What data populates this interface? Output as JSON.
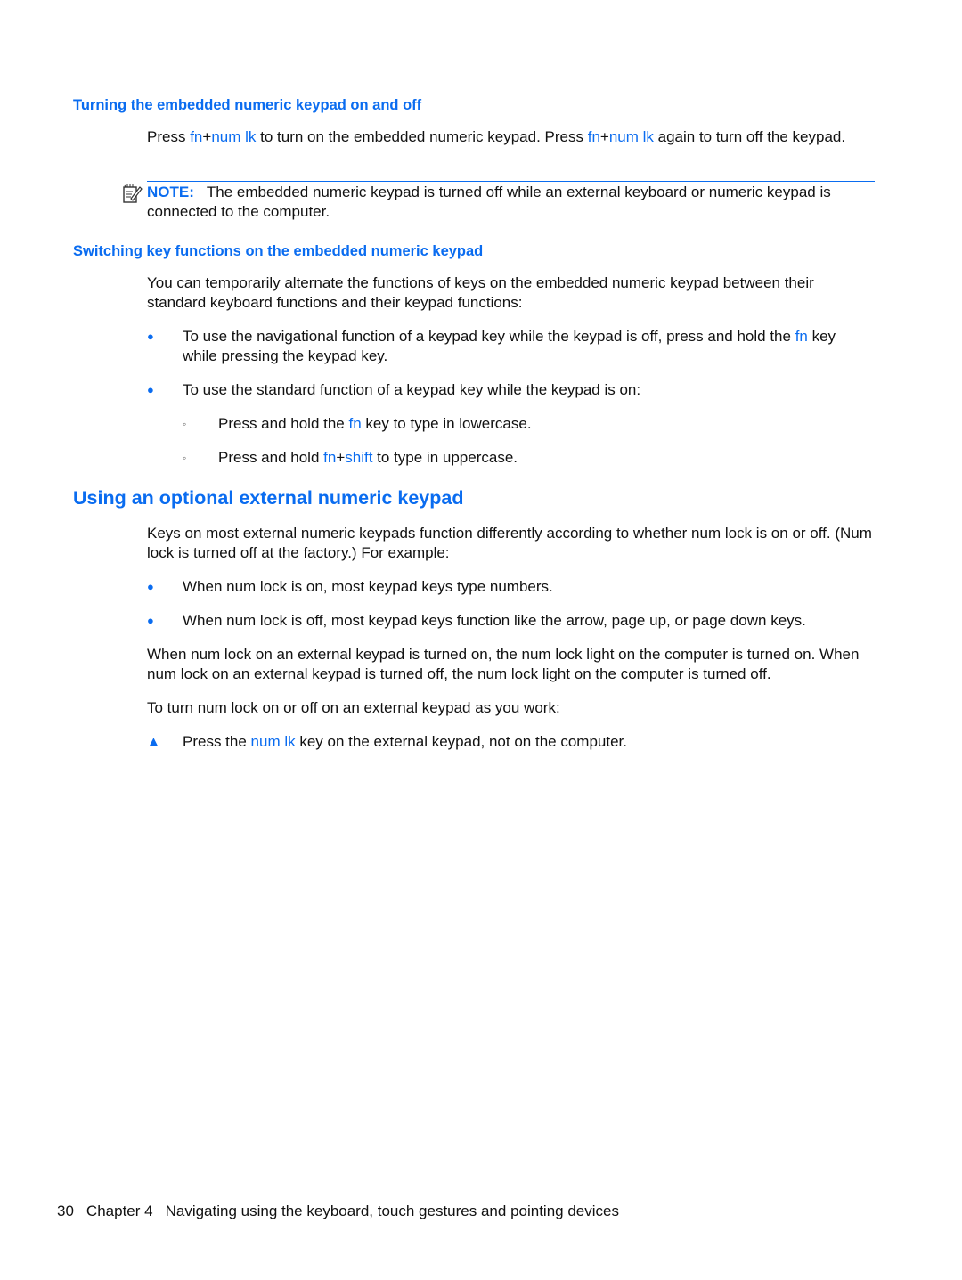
{
  "section1": {
    "heading": "Turning the embedded numeric keypad on and off",
    "para": [
      {
        "t": "Press ",
        "k": false
      },
      {
        "t": "fn",
        "k": true
      },
      {
        "t": "+",
        "k": false
      },
      {
        "t": "num lk",
        "k": true
      },
      {
        "t": " to turn on the embedded numeric keypad. Press ",
        "k": false
      },
      {
        "t": "fn",
        "k": true
      },
      {
        "t": "+",
        "k": false
      },
      {
        "t": "num lk",
        "k": true
      },
      {
        "t": " again to turn off the keypad.",
        "k": false
      }
    ],
    "note": {
      "icon": "note-icon",
      "label": "NOTE:",
      "text": "The embedded numeric keypad is turned off while an external keyboard or numeric keypad is connected to the computer."
    }
  },
  "section2": {
    "heading": "Switching key functions on the embedded numeric keypad",
    "intro": "You can temporarily alternate the functions of keys on the embedded numeric keypad between their standard keyboard functions and their keypad functions:",
    "bullets": [
      [
        {
          "t": "To use the navigational function of a keypad key while the keypad is off, press and hold the ",
          "k": false
        },
        {
          "t": "fn",
          "k": true
        },
        {
          "t": " key while pressing the keypad key.",
          "k": false
        }
      ],
      [
        {
          "t": "To use the standard function of a keypad key while the keypad is on:",
          "k": false
        }
      ]
    ],
    "sub_bullets": [
      [
        {
          "t": "Press and hold the ",
          "k": false
        },
        {
          "t": "fn",
          "k": true
        },
        {
          "t": " key to type in lowercase.",
          "k": false
        }
      ],
      [
        {
          "t": "Press and hold ",
          "k": false
        },
        {
          "t": "fn",
          "k": true
        },
        {
          "t": "+",
          "k": false
        },
        {
          "t": "shift",
          "k": true
        },
        {
          "t": " to type in uppercase.",
          "k": false
        }
      ]
    ]
  },
  "section3": {
    "heading": "Using an optional external numeric keypad",
    "intro": "Keys on most external numeric keypads function differently according to whether num lock is on or off. (Num lock is turned off at the factory.) For example:",
    "bullets": [
      "When num lock is on, most keypad keys type numbers.",
      "When num lock is off, most keypad keys function like the arrow, page up, or page down keys."
    ],
    "para2": "When num lock on an external keypad is turned on, the num lock light on the computer is turned on. When num lock on an external keypad is turned off, the num lock light on the computer is turned off.",
    "para3": "To turn num lock on or off on an external keypad as you work:",
    "step": [
      {
        "t": "Press the ",
        "k": false
      },
      {
        "t": "num lk",
        "k": true
      },
      {
        "t": " key on the external keypad, not on the computer.",
        "k": false
      }
    ]
  },
  "footer": {
    "page_number": "30",
    "chapter": "Chapter 4",
    "title": "Navigating using the keyboard, touch gestures and pointing devices"
  }
}
